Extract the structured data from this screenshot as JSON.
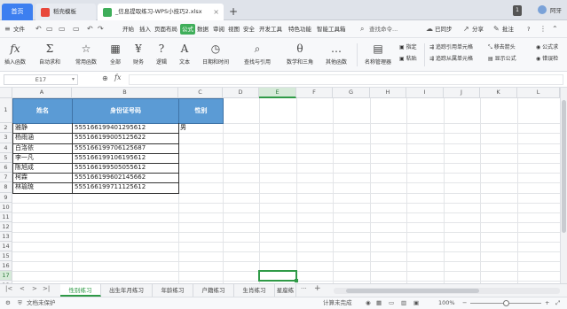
{
  "titlebar": {
    "home_tab": "首页",
    "tabs": [
      {
        "label": "稻壳模板",
        "icon": "docer-icon",
        "color": "#e8473b"
      },
      {
        "label": "_信息提取练习-WPS小技巧2.xlsx",
        "icon": "spreadsheet-file-icon",
        "color": "#3fae5a"
      }
    ],
    "window_count": "1",
    "user_name": "阿牙"
  },
  "menubar": {
    "file": "文件",
    "items": [
      "开始",
      "插入",
      "页面布局",
      "公式",
      "数据",
      "审阅",
      "视图",
      "安全",
      "开发工具",
      "特色功能",
      "智能工具箱"
    ],
    "active_item": "公式",
    "search_placeholder": "查找命令...",
    "sync": "已同步",
    "share": "分享",
    "comment": "批注",
    "help": "?"
  },
  "ribbon": {
    "buttons": [
      {
        "glyph": "fx",
        "label": "插入函数"
      },
      {
        "glyph": "Σ",
        "label": "自动求和"
      },
      {
        "glyph": "☆",
        "label": "常用函数"
      },
      {
        "glyph": "▦",
        "label": "全部"
      },
      {
        "glyph": "¥",
        "label": "财务"
      },
      {
        "glyph": "?",
        "label": "逻辑"
      },
      {
        "glyph": "A",
        "label": "文本"
      },
      {
        "glyph": "◷",
        "label": "日期和时间"
      },
      {
        "glyph": "⌕",
        "label": "查找与引用"
      },
      {
        "glyph": "θ",
        "label": "数学和三角"
      },
      {
        "glyph": "…",
        "label": "其他函数"
      },
      {
        "glyph": "▤",
        "label": "名称管理器"
      }
    ],
    "small_buttons": [
      "指定",
      "粘贴",
      "追踪引用单元格",
      "追踪从属单元格",
      "移去箭头",
      "显示公式",
      "公式求",
      "错误检"
    ]
  },
  "formula_bar": {
    "cell_ref": "E17",
    "fx": "fx",
    "formula": ""
  },
  "grid": {
    "columns": [
      "A",
      "B",
      "C",
      "D",
      "E",
      "F",
      "G",
      "H",
      "I",
      "J",
      "K",
      "L"
    ],
    "selected_column": "E",
    "rows": [
      "1",
      "2",
      "3",
      "4",
      "5",
      "6",
      "7",
      "8",
      "9",
      "10",
      "11",
      "12",
      "13",
      "14",
      "15",
      "16",
      "17",
      "18"
    ],
    "selected_row": "17",
    "headers": {
      "name": "姓名",
      "id": "身份证号码",
      "gender": "性别"
    },
    "data": [
      {
        "name": "雅静",
        "id": "555166199401295612",
        "gender": "男"
      },
      {
        "name": "杨雨涵",
        "id": "555166199005125622",
        "gender": ""
      },
      {
        "name": "白洛依",
        "id": "555166199706125687",
        "gender": ""
      },
      {
        "name": "李一凡",
        "id": "555166199106195612",
        "gender": ""
      },
      {
        "name": "陈旭成",
        "id": "555166199505055612",
        "gender": ""
      },
      {
        "name": "柯霖",
        "id": "555166199602145662",
        "gender": ""
      },
      {
        "name": "林瑜琉",
        "id": "555166199711125612",
        "gender": ""
      }
    ]
  },
  "sheets": {
    "tabs": [
      "性别练习",
      "出生年月练习",
      "年龄练习",
      "户籍练习",
      "生肖练习",
      "星座练"
    ],
    "active": "性别练习",
    "more": "···",
    "add": "+"
  },
  "statusbar": {
    "protection": "文档未保护",
    "status": "计算未完成",
    "zoom": "100%",
    "zoom_minus": "−",
    "zoom_plus": "+",
    "zoom_level": 0.45
  }
}
